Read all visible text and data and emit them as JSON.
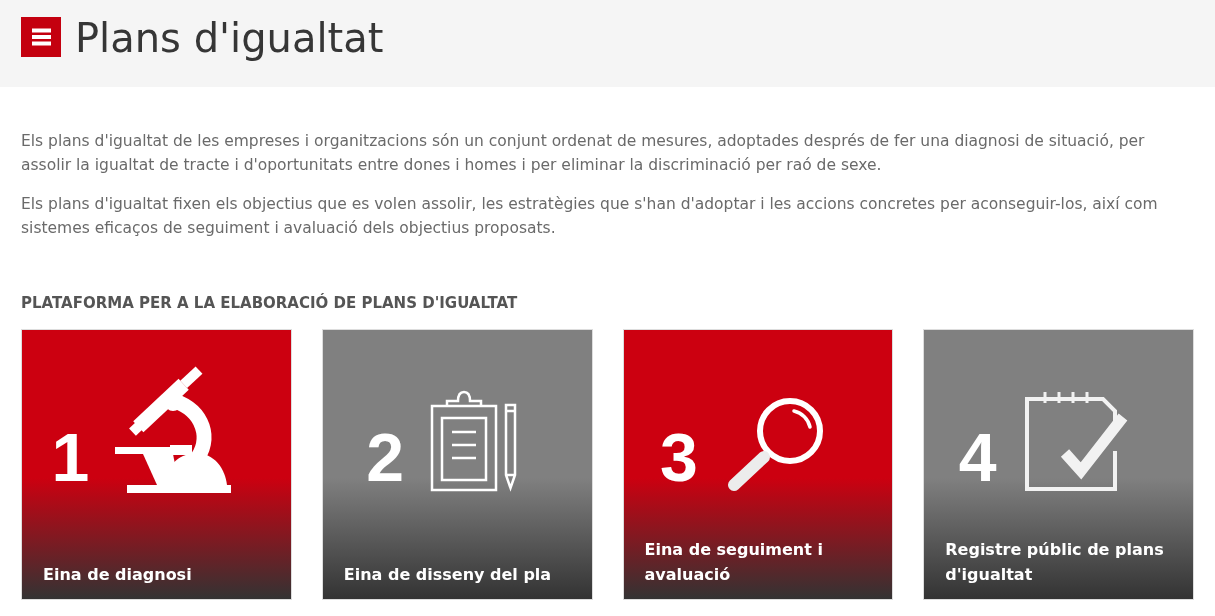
{
  "header": {
    "title": "Plans d'igualtat"
  },
  "intro": {
    "paragraphs": [
      "Els plans d'igualtat de les empreses i organitzacions són un conjunt ordenat de mesures, adoptades després de fer una diagnosi de situació, per assolir la igualtat de tracte i d'oportunitats entre dones i homes i per eliminar la discriminació per raó de sexe.",
      "Els plans d'igualtat fixen els objectius que es volen assolir, les estratègies que s'han d'adoptar i les accions concretes per aconseguir-los, així com sistemes eficaços de seguiment i avaluació dels objectius proposats."
    ]
  },
  "platform": {
    "heading": "PLATAFORMA PER A LA ELABORACIÓ DE PLANS D'IGUALTAT",
    "cards": [
      {
        "number": "1",
        "title": "Eina de diagnosi",
        "color": "#cc0010"
      },
      {
        "number": "2",
        "title": "Eina de disseny del pla",
        "color": "#808080"
      },
      {
        "number": "3",
        "title": "Eina de seguiment i avaluació",
        "color": "#cc0010"
      },
      {
        "number": "4",
        "title": "Registre públic de plans d'igualtat",
        "color": "#808080"
      }
    ]
  }
}
